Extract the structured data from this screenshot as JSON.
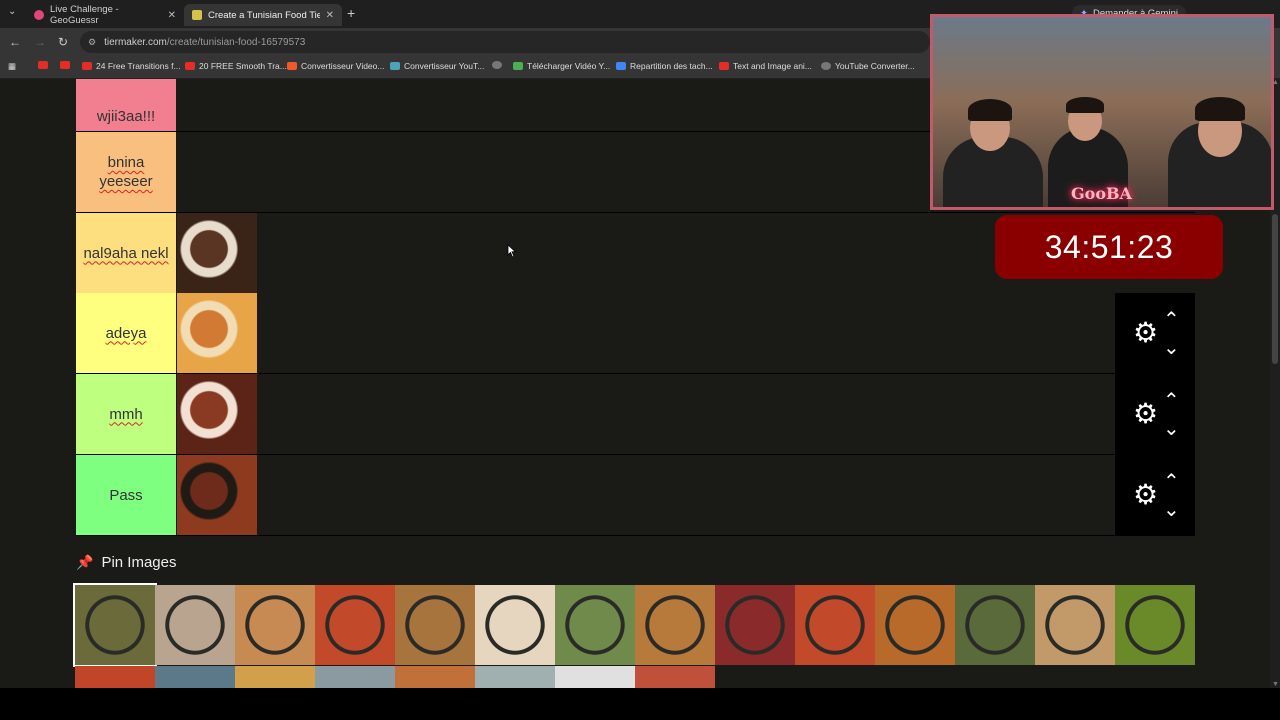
{
  "browser": {
    "tabs": [
      {
        "title": "Live Challenge - GeoGuessr",
        "active": false
      },
      {
        "title": "Create a Tunisian Food Tier List",
        "active": true
      }
    ],
    "gemini_button": "Demander à Gemini",
    "url_host": "tiermaker.com",
    "url_path": "/create/tunisian-food-16579573",
    "bookmarks": [
      "24 Free Transitions f...",
      "20 FREE Smooth Tra...",
      "Convertisseur Video...",
      "Convertisseur YouT...",
      "",
      "Télécharger Vidéo Y...",
      "Repartition des tach...",
      "Text and Image ani...",
      "YouTube Converter..."
    ]
  },
  "tiers": [
    {
      "label": "wjii3aa!!!",
      "color": "#f17f8f",
      "underline": false,
      "has_item": false,
      "item_colors": []
    },
    {
      "label": "bnina yeeseer",
      "color": "#f9bf7f",
      "underline": true,
      "has_item": false,
      "item_colors": []
    },
    {
      "label": "nal9aha nekl",
      "color": "#fddf7f",
      "underline": true,
      "has_item": true,
      "item_colors": [
        "#5a3524",
        "#e8dccd",
        "#3a2417"
      ]
    },
    {
      "label": "adeya",
      "color": "#fefe7f",
      "underline": true,
      "has_item": true,
      "item_colors": [
        "#d27934",
        "#f2dcb3",
        "#e7a548"
      ]
    },
    {
      "label": "mmh",
      "color": "#bfff7f",
      "underline": true,
      "has_item": true,
      "item_colors": [
        "#8a3a22",
        "#f2e1d2",
        "#5b2416"
      ]
    },
    {
      "label": "Pass",
      "color": "#7fff7f",
      "underline": false,
      "has_item": true,
      "item_colors": [
        "#6e2a1a",
        "#1f1a14",
        "#8e3a1f"
      ]
    }
  ],
  "pin_images_title": "Pin Images",
  "pool_colors": [
    "#6a6a3a",
    "#b9a48f",
    "#c68a52",
    "#c24a2a",
    "#a7743d",
    "#e6d6c0",
    "#6f8a4b",
    "#b87a3a",
    "#8a2a2a",
    "#c24a2a",
    "#b86a2a",
    "#5a6a3a",
    "#c29a6a",
    "#6a8a2a"
  ],
  "pool_row2_colors": [
    "#c2452a",
    "#5a7a8a",
    "#d2a04a",
    "#8a9aa0",
    "#c2703a",
    "#a0b0b0",
    "#e0e0e0",
    "#c0503a"
  ],
  "stream_overlay": {
    "neon_sign": "GooBA",
    "timer": "34:51:23"
  }
}
